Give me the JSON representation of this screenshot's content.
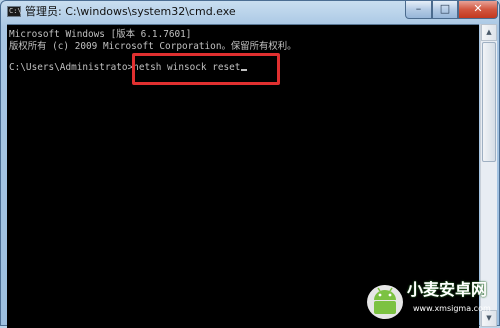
{
  "window": {
    "title": "管理员: C:\\windows\\system32\\cmd.exe",
    "icon_label": "C:\\",
    "buttons": {
      "minimize": "–",
      "maximize": "□",
      "close": "✕"
    }
  },
  "console": {
    "lines": [
      "Microsoft Windows [版本 6.1.7601]",
      "版权所有 (c) 2009 Microsoft Corporation。保留所有权利。",
      "",
      "C:\\Users\\Administrator>netsh winsock reset"
    ],
    "prompt": "C:\\Users\\Administrato",
    "command": ">netsh winsock reset"
  },
  "annotation": {
    "color": "#e03030"
  },
  "watermark": {
    "name": "小麦安卓网",
    "url": "www.xmsigma.com"
  }
}
